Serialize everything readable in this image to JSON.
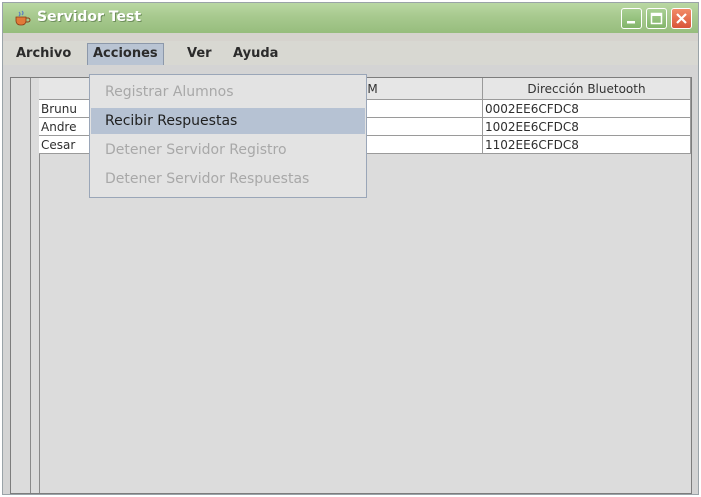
{
  "window": {
    "title": "Servidor Test",
    "buttons": [
      "minimize",
      "maximize",
      "close"
    ]
  },
  "menubar": {
    "items": [
      {
        "label": "Archivo"
      },
      {
        "label": "Acciones",
        "active": true
      },
      {
        "label": "Ver"
      },
      {
        "label": "Ayuda"
      }
    ]
  },
  "dropdown": {
    "items": [
      {
        "label": "Registrar Alumnos",
        "enabled": false
      },
      {
        "label": "Recibir Respuestas",
        "enabled": true,
        "selected": true
      },
      {
        "label": "Detener Servidor Registro",
        "enabled": false
      },
      {
        "label": "Detener Servidor Respuestas",
        "enabled": false
      }
    ]
  },
  "table": {
    "headers": [
      "",
      "USM",
      "Dirección Bluetooth"
    ],
    "rows": [
      [
        "Brunu",
        "",
        "0002EE6CFDC8"
      ],
      [
        "Andre",
        "",
        "1002EE6CFDC8"
      ],
      [
        "Cesar",
        "",
        "1102EE6CFDC8"
      ]
    ]
  },
  "colors": {
    "titlebar": "#a7c98e",
    "menu_selection": "#b6c2d3",
    "close_button": "#d9553a"
  },
  "icons": [
    "java-cup-icon",
    "minimize-icon",
    "maximize-icon",
    "close-icon"
  ]
}
